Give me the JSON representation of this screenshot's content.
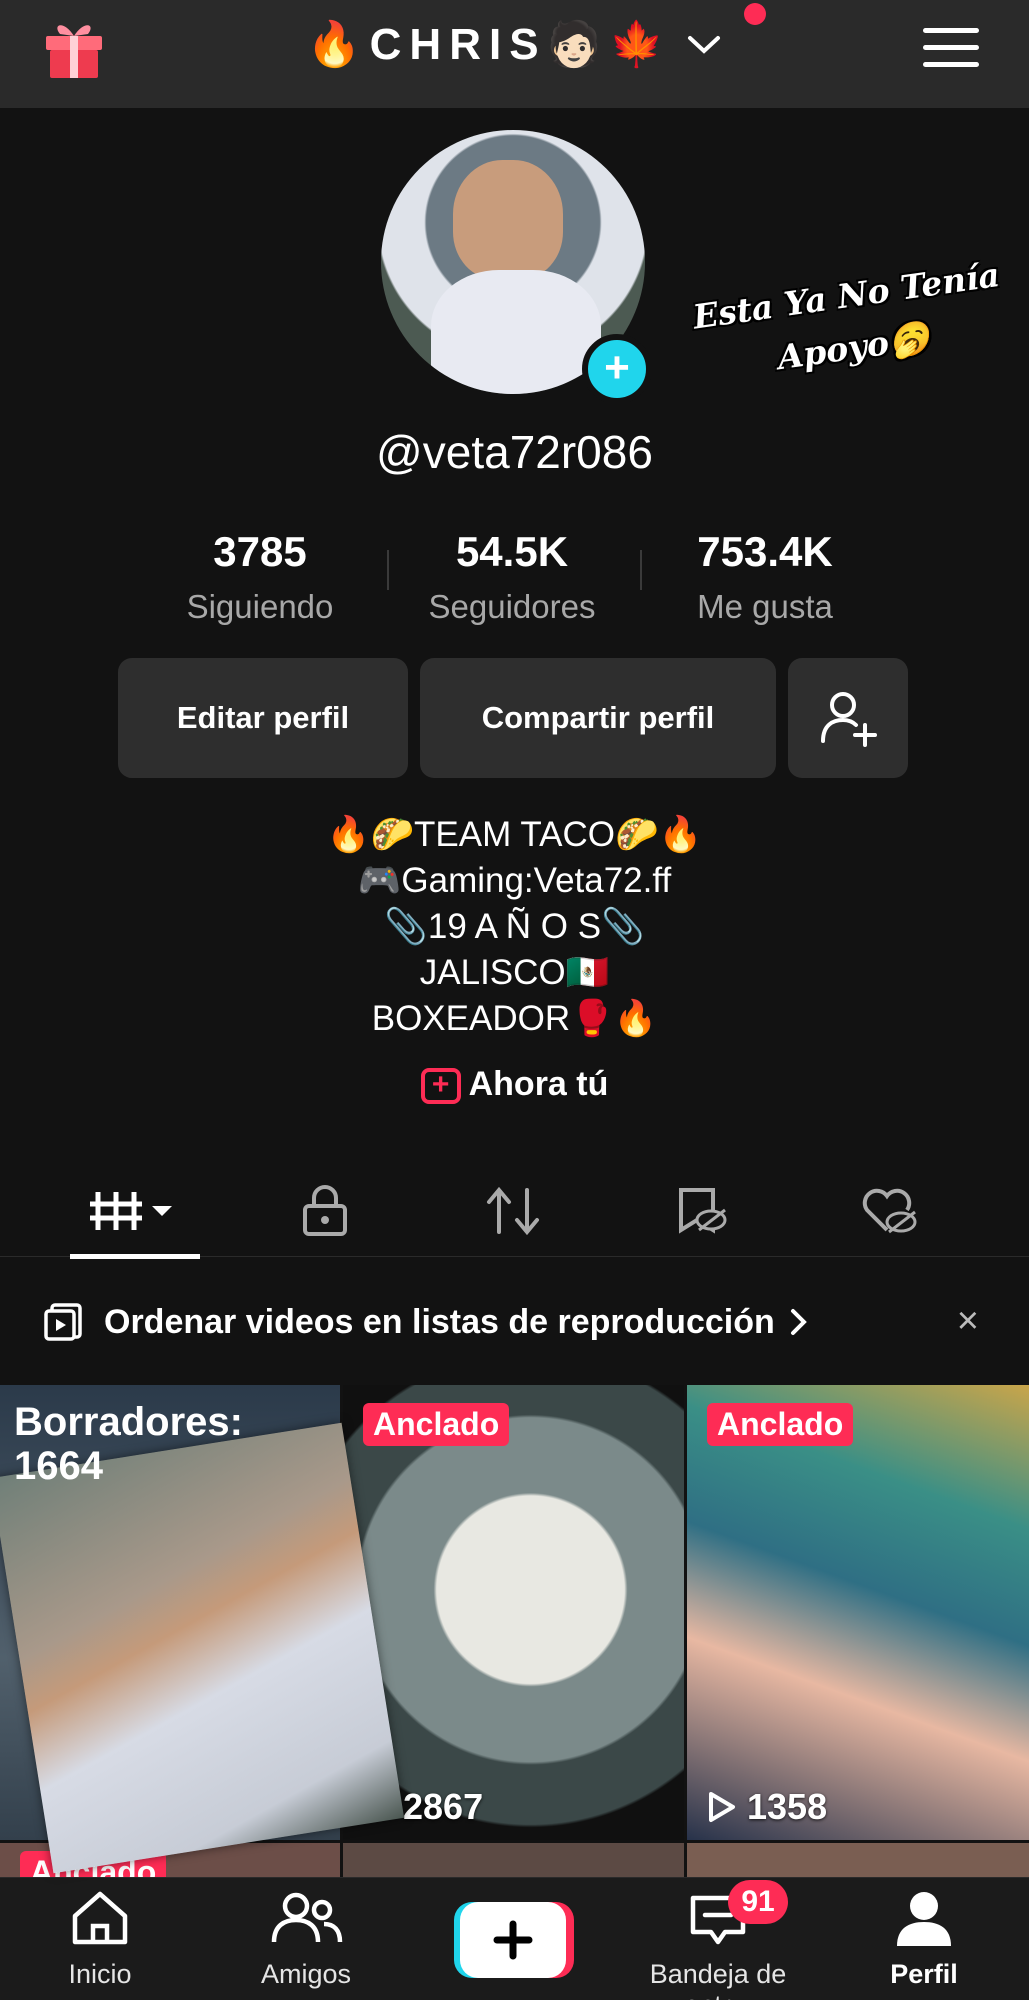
{
  "header": {
    "title": "🔥CHRIS🧑🏻🍁",
    "gift_icon": "gift-icon",
    "menu_icon": "hamburger-menu-icon",
    "notification_dot_color": "#fe2c55"
  },
  "profile": {
    "username": "@veta72r086",
    "sticker_text": "Esta Ya No Tenía Apoyo🥱",
    "stats": [
      {
        "value": "3785",
        "label": "Siguiendo"
      },
      {
        "value": "54.5K",
        "label": "Seguidores"
      },
      {
        "value": "753.4K",
        "label": "Me gusta"
      }
    ],
    "buttons": {
      "edit": "Editar perfil",
      "share": "Compartir perfil"
    },
    "bio": [
      "🔥🌮TEAM TACO🌮🔥",
      "🎮Gaming:Veta72.ff",
      "📎19 A Ñ O S📎",
      "JALISCO🇲🇽",
      "BOXEADOR🥊🔥"
    ],
    "ahora_tu": "Ahora tú"
  },
  "tabs": [
    {
      "icon": "grid-icon",
      "active": true
    },
    {
      "icon": "lock-icon"
    },
    {
      "icon": "repost-icon"
    },
    {
      "icon": "saved-hidden-icon"
    },
    {
      "icon": "liked-hidden-icon"
    }
  ],
  "playlist_banner": {
    "text": "Ordenar videos en listas de reproducción",
    "close": "×"
  },
  "grid": {
    "drafts_label": "Borradores:",
    "drafts_count": "1664",
    "videos": [
      {
        "badge": "Anclado",
        "views": "2867"
      },
      {
        "badge": "Anclado",
        "views": "1358"
      }
    ],
    "partial_badge": "Anclado"
  },
  "bottom_nav": {
    "items": [
      {
        "label": "Inicio",
        "icon": "home-icon"
      },
      {
        "label": "Amigos",
        "icon": "friends-icon"
      },
      {
        "label": "",
        "icon": "create-plus-icon"
      },
      {
        "label": "Bandeja de entr...",
        "icon": "inbox-icon"
      },
      {
        "label": "Perfil",
        "icon": "profile-icon"
      }
    ],
    "inbox_badge": "91"
  },
  "colors": {
    "accent": "#fe2c55",
    "cyan": "#20d5ec",
    "background": "#121212"
  }
}
